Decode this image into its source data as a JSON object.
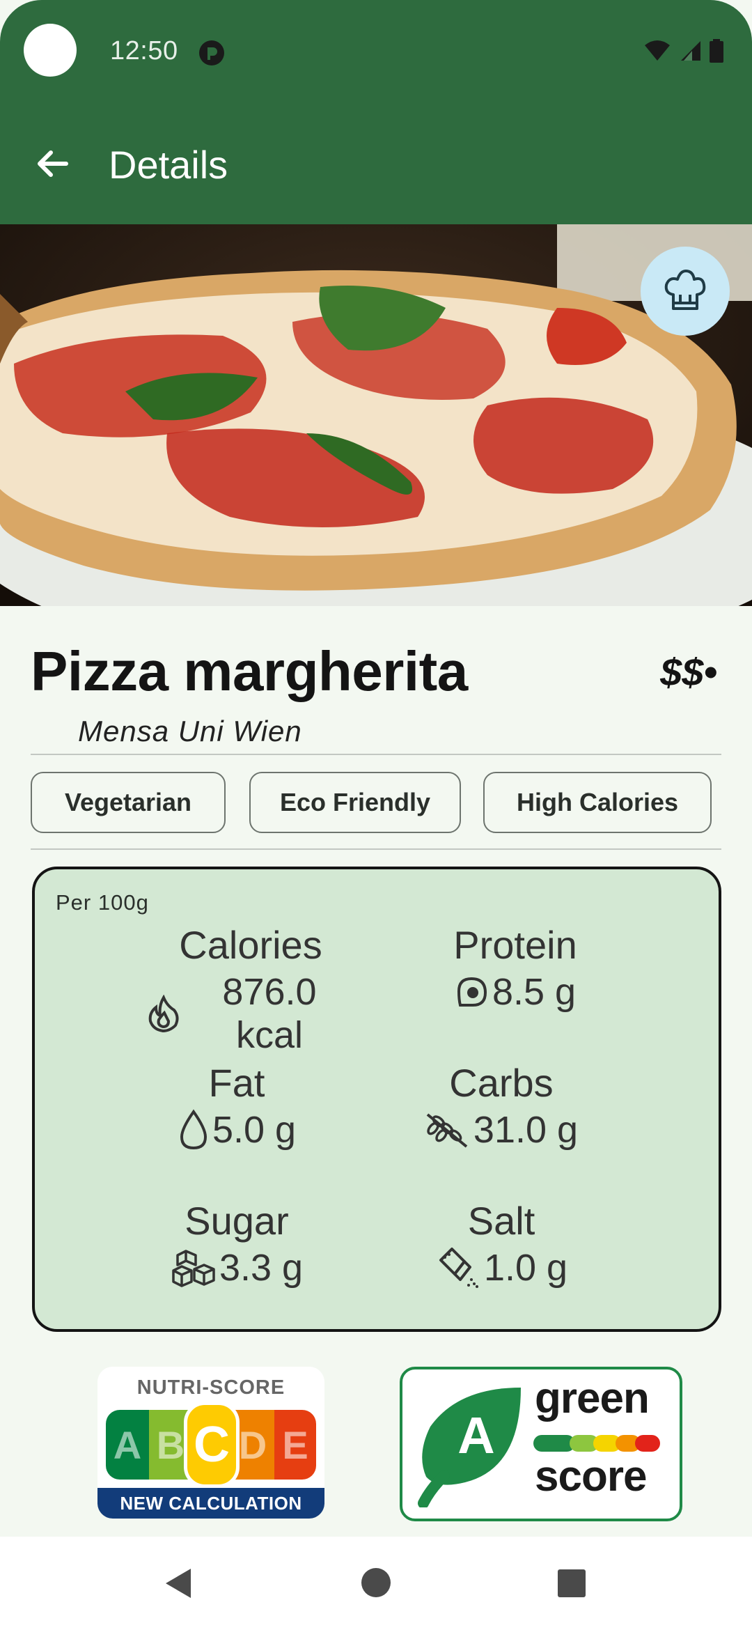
{
  "status_bar": {
    "time": "12:50"
  },
  "app_bar": {
    "title": "Details"
  },
  "dish": {
    "name": "Pizza margherita",
    "price": "$$•",
    "place": "Mensa Uni Wien"
  },
  "tags": [
    "Vegetarian",
    "Eco Friendly",
    "High Calories"
  ],
  "nutrition": {
    "per": "Per 100g",
    "items": [
      {
        "label": "Calories",
        "value": "876.0 kcal",
        "icon": "flame-icon"
      },
      {
        "label": "Protein",
        "value": "8.5 g",
        "icon": "protein-icon"
      },
      {
        "label": "Fat",
        "value": "5.0 g",
        "icon": "drop-icon"
      },
      {
        "label": "Carbs",
        "value": "31.0 g",
        "icon": "wheat-icon"
      },
      {
        "label": "Sugar",
        "value": "3.3 g",
        "icon": "sugar-cubes-icon"
      },
      {
        "label": "Salt",
        "value": "1.0 g",
        "icon": "salt-shaker-icon"
      }
    ]
  },
  "nutri_score": {
    "title": "NUTRI-SCORE",
    "footer": "NEW CALCULATION",
    "grades": [
      "A",
      "B",
      "C",
      "D",
      "E"
    ],
    "active": "C",
    "colors": [
      "#038141",
      "#85bb2f",
      "#fecb02",
      "#ee8100",
      "#e63e11"
    ]
  },
  "green_score": {
    "grade": "A",
    "word_top": "green",
    "word_bottom": "score",
    "colors": [
      "#1f8a47",
      "#8dc63f",
      "#f5d400",
      "#f39200",
      "#e2231a"
    ]
  },
  "colors": {
    "primary": "#2e6b3e",
    "surface": "#f3f8f1",
    "card": "#d3e8d3",
    "chef_button": "#c9e9f6"
  }
}
